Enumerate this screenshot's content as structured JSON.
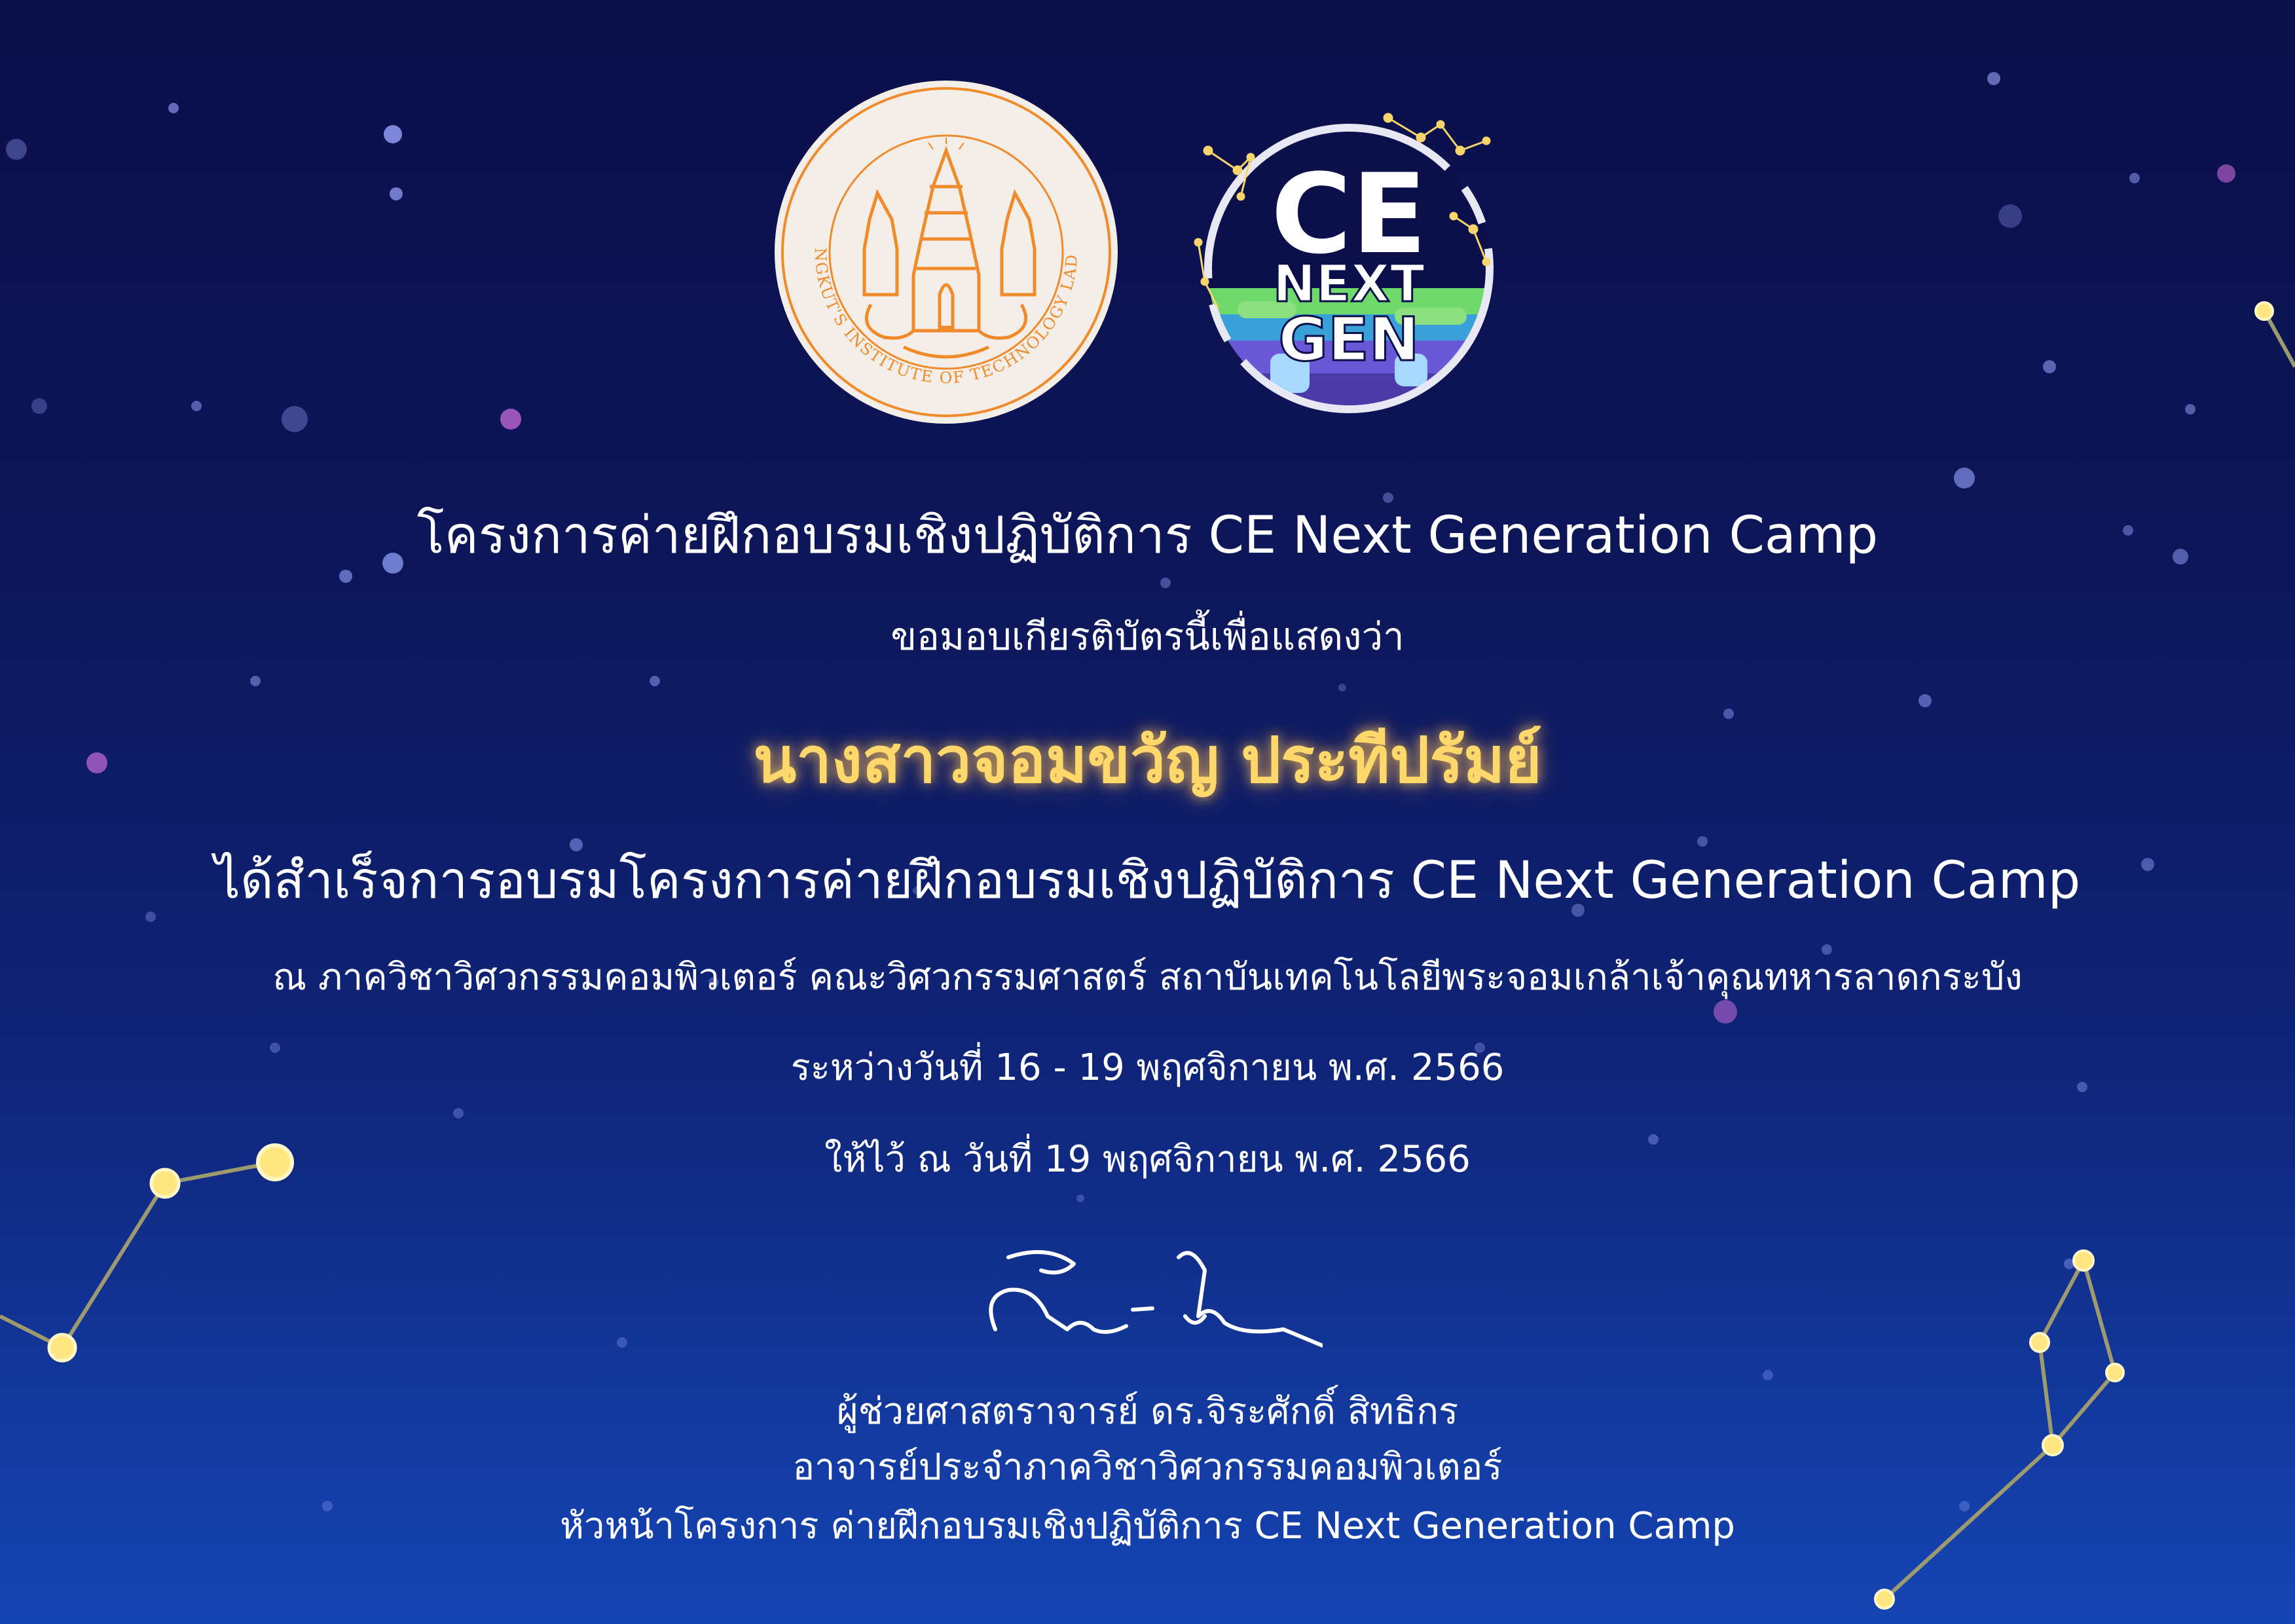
{
  "logos": {
    "university_seal_text": "KING MONGKUT'S INSTITUTE OF TECHNOLOGY LADKRABANG",
    "camp_logo_text": [
      "CE",
      "NEXT",
      "GEN"
    ]
  },
  "certificate": {
    "org_title": "โครงการค่ายฝึกอบรมเชิงปฏิบัติการ CE Next Generation Camp",
    "intro": "ขอมอบเกียรติบัตรนี้เพื่อแสดงว่า",
    "recipient": "นางสาวจอมขวัญ ประทีปรัมย์",
    "achievement": "ได้สำเร็จการอบรมโครงการค่ายฝึกอบรมเชิงปฏิบัติการ CE Next Generation Camp",
    "venue": "ณ ภาควิชาวิศวกรรมคอมพิวเตอร์ คณะวิศวกรรมศาสตร์ สถาบันเทคโนโลยีพระจอมเกล้าเจ้าคุณทหารลาดกระบัง",
    "dates": "ระหว่างวันที่ 16 - 19 พฤศจิกายน พ.ศ. 2566",
    "given_on": "ให้ไว้ ณ วันที่ 19 พฤศจิกายน พ.ศ. 2566"
  },
  "signer": {
    "name": "ผู้ช่วยศาสตราจารย์ ดร.จิระศักดิ์ สิทธิกร",
    "position_1": "อาจารย์ประจำภาควิชาวิศวกรรมคอมพิวเตอร์",
    "position_2": "หัวหน้าโครงการ ค่ายฝึกอบรมเชิงปฏิบัติการ CE Next Generation Camp"
  },
  "colors": {
    "background_top": "#0b0f4a",
    "background_bottom": "#1545b4",
    "recipient_gold": "#ffd86b",
    "seal_orange": "#f08a2a",
    "constellation_yellow": "#ffe680",
    "text_white": "#ffffff"
  }
}
